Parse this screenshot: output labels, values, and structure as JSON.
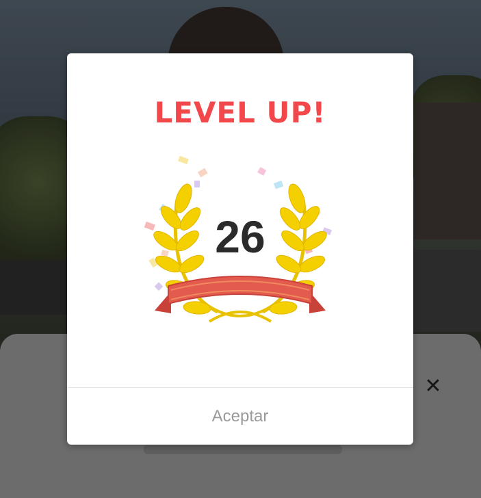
{
  "dialog": {
    "title": "LEVEL UP!",
    "level": "26",
    "accept_label": "Aceptar"
  },
  "sheet": {
    "close_icon": "close-icon"
  },
  "colors": {
    "title": "#f2484c",
    "laurel": "#f5d000",
    "ribbon": "#e35a4f",
    "level_text": "#2b2b2b",
    "accept_text": "#9a9a9a"
  }
}
